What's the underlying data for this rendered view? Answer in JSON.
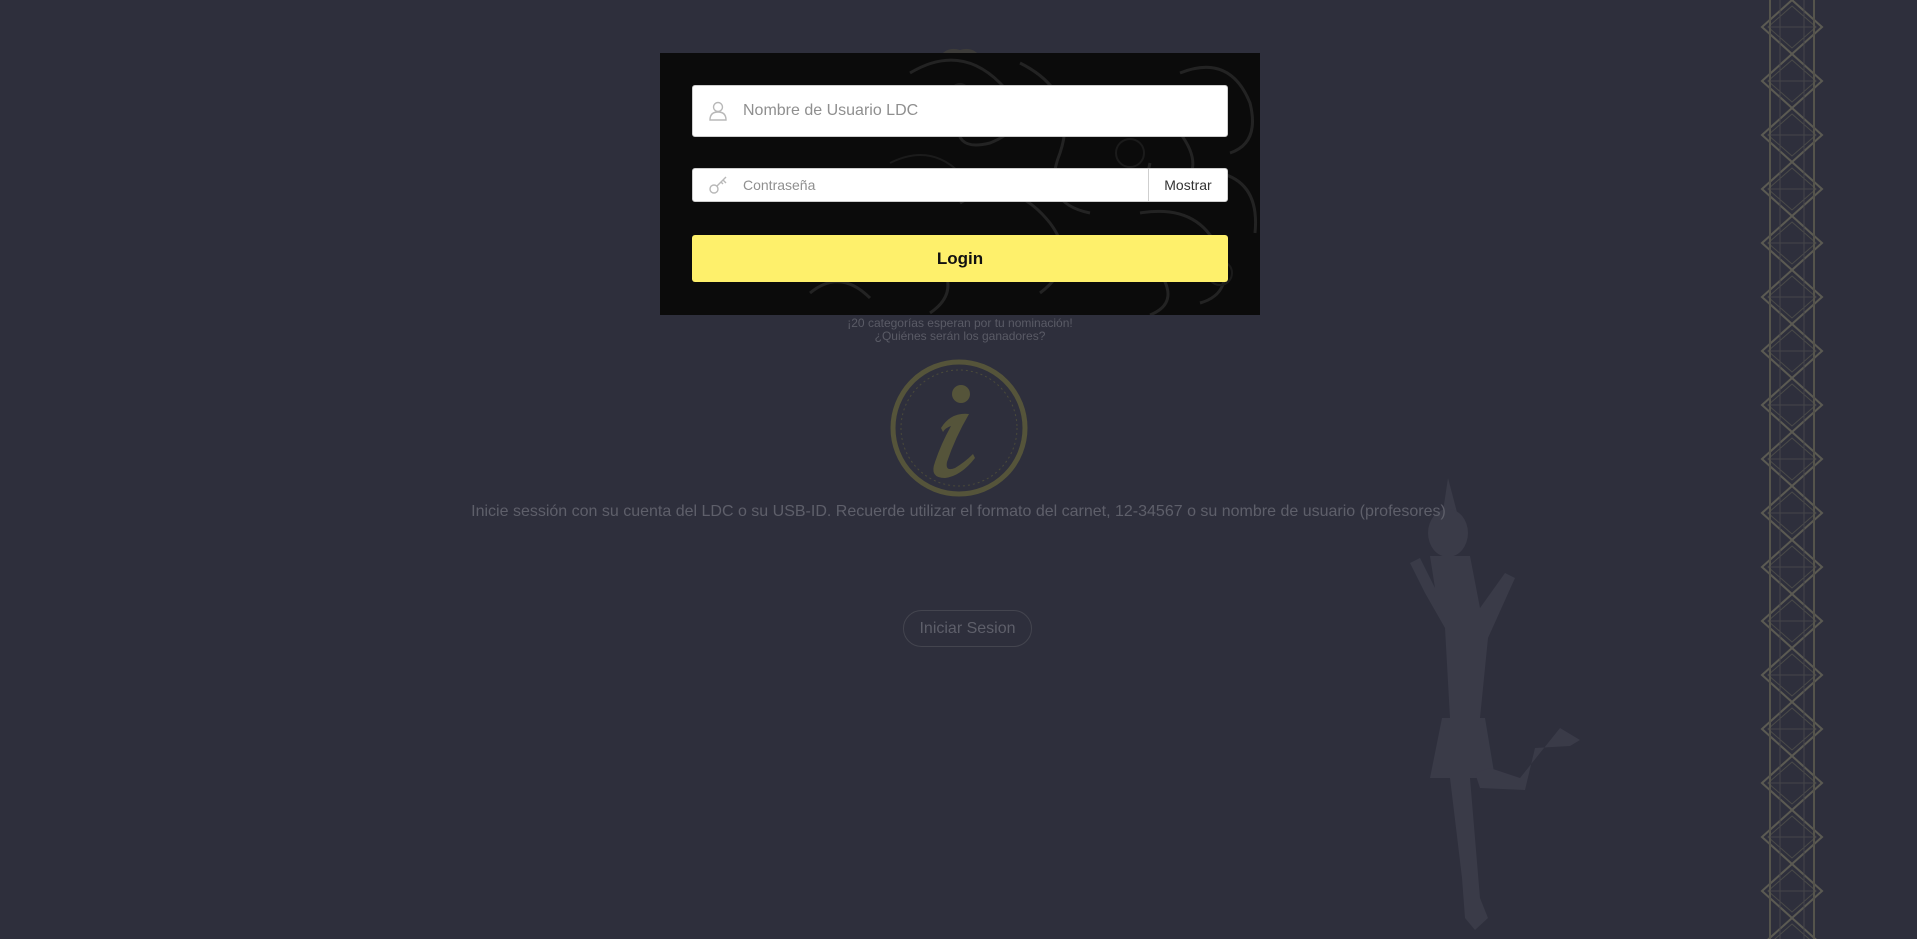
{
  "login": {
    "username_placeholder": "Nombre de Usuario LDC",
    "username_value": "",
    "password_placeholder": "Contraseña",
    "password_value": "",
    "show_label": "Mostrar",
    "login_label": "Login"
  },
  "tagline": {
    "line1": "¡20 categorías esperan por tu nominación!",
    "line2": "¿Quiénes serán los ganadores?"
  },
  "info": {
    "message": "Inicie sessión con su cuenta del LDC o su USB-ID. Recuerde utilizar el formato del carnet, 12-34567 o su nombre de usuario (profesores)",
    "start_label": "Iniciar Sesion"
  },
  "icons": {
    "user": "user-icon",
    "key": "key-icon",
    "info": "info-logo-icon"
  },
  "colors": {
    "background": "#2e2f3c",
    "panel": "#0b0b0b",
    "accent": "#fef06b",
    "logo": "#55543a"
  }
}
